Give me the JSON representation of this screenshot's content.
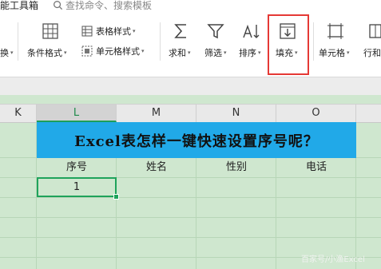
{
  "ribbon": {
    "tab_partial": "能工具箱",
    "search_placeholder": "查找命令、搜索模板",
    "buttons": {
      "table_style": "表格样式",
      "conditional_format": "条件格式",
      "cell_style": "单元格样式",
      "sum": "求和",
      "filter": "筛选",
      "sort": "排序",
      "fill": "填充",
      "cell": "单元格",
      "row_col": "行和",
      "left_partial": "换"
    }
  },
  "grid": {
    "columns": [
      "K",
      "L",
      "M",
      "N",
      "O"
    ],
    "active_column": "L",
    "title": "Excel表怎样一键快速设置序号呢？",
    "headers": [
      "序号",
      "姓名",
      "性别",
      "电话"
    ],
    "selected_cell_value": "1"
  },
  "watermark": "百家号/小渔Excel",
  "colors": {
    "title_band": "#21a9e8",
    "grid_bg": "#cfe7cf",
    "selection": "#1fa35b",
    "highlight_box": "#e53935"
  }
}
